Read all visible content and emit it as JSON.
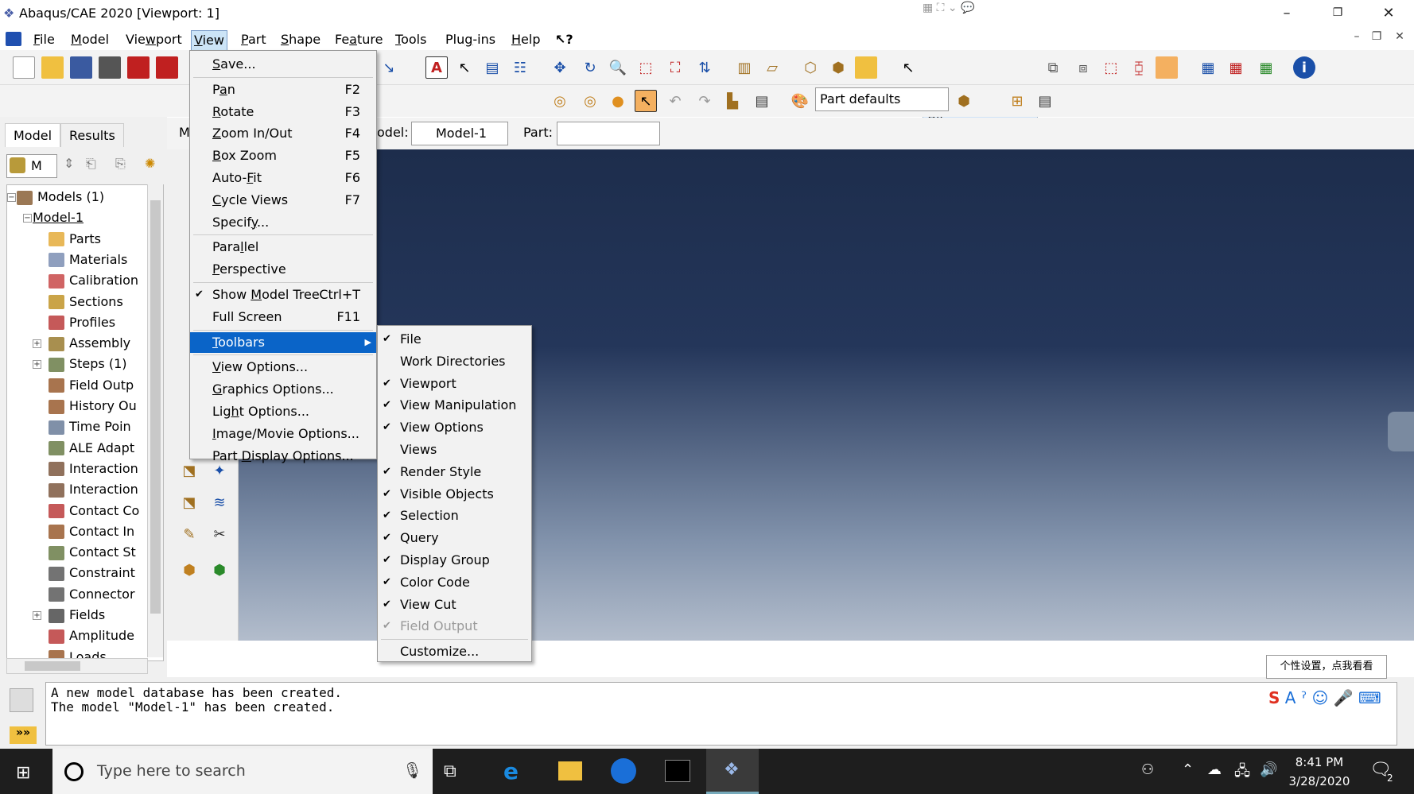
{
  "window": {
    "title": "Abaqus/CAE 2020 [Viewport: 1]",
    "minimize": "–",
    "restore": "❐",
    "close": "✕"
  },
  "menubar": {
    "items": [
      "File",
      "Model",
      "Viewport",
      "View",
      "Part",
      "Shape",
      "Feature",
      "Tools",
      "Plug-ins",
      "Help",
      "⁋?"
    ],
    "help_pointer": "↖?"
  },
  "toolbar": {
    "selection_filter": "All",
    "render_defaults": "Part defaults"
  },
  "context": {
    "module_label": "M",
    "model_label": "odel:",
    "model_value": "Model-1",
    "part_label": "Part:",
    "part_value": ""
  },
  "left_panel": {
    "tabs": [
      "Model",
      "Results"
    ],
    "combo": "M",
    "tree": [
      {
        "label": "Models (1)",
        "level": 0,
        "exp": "−",
        "color": "#7a4b1c"
      },
      {
        "label": "Model-1",
        "level": 1,
        "exp": "−",
        "color": ""
      },
      {
        "label": "Parts",
        "level": 2,
        "exp": "",
        "color": "#e0a020"
      },
      {
        "label": "Materials",
        "level": 2,
        "exp": "",
        "color": "#6a7fa8"
      },
      {
        "label": "Calibration",
        "level": 2,
        "exp": "",
        "color": "#c03030"
      },
      {
        "label": "Sections",
        "level": 2,
        "exp": "",
        "color": "#b8860b"
      },
      {
        "label": "Profiles",
        "level": 2,
        "exp": "",
        "color": "#b22222"
      },
      {
        "label": "Assembly",
        "level": 2,
        "exp": "+",
        "color": "#8b6914"
      },
      {
        "label": "Steps (1)",
        "level": 2,
        "exp": "+",
        "color": "#556b2f"
      },
      {
        "label": "Field Outp",
        "level": 2,
        "exp": "",
        "color": "#8b4513"
      },
      {
        "label": "History Ou",
        "level": 2,
        "exp": "",
        "color": "#8b4513"
      },
      {
        "label": "Time Poin",
        "level": 2,
        "exp": "",
        "color": "#556b8b"
      },
      {
        "label": "ALE Adapt",
        "level": 2,
        "exp": "",
        "color": "#556b2f"
      },
      {
        "label": "Interaction",
        "level": 2,
        "exp": "",
        "color": "#6b4226"
      },
      {
        "label": "Interaction",
        "level": 2,
        "exp": "",
        "color": "#6b4226"
      },
      {
        "label": "Contact Co",
        "level": 2,
        "exp": "",
        "color": "#b22222"
      },
      {
        "label": "Contact In",
        "level": 2,
        "exp": "",
        "color": "#8b4513"
      },
      {
        "label": "Contact St",
        "level": 2,
        "exp": "",
        "color": "#556b2f"
      },
      {
        "label": "Constraint",
        "level": 2,
        "exp": "",
        "color": "#444444"
      },
      {
        "label": "Connector",
        "level": 2,
        "exp": "",
        "color": "#444444"
      },
      {
        "label": "Fields",
        "level": 2,
        "exp": "+",
        "color": "#333333"
      },
      {
        "label": "Amplitude",
        "level": 2,
        "exp": "",
        "color": "#b22222"
      },
      {
        "label": "Loads",
        "level": 2,
        "exp": "",
        "color": "#8b4513"
      }
    ]
  },
  "view_menu": [
    {
      "label": "Save...",
      "u": "S",
      "accel": ""
    },
    {
      "sep": true
    },
    {
      "label": "Pan",
      "u": "a",
      "accel": "F2"
    },
    {
      "label": "Rotate",
      "u": "R",
      "accel": "F3"
    },
    {
      "label": "Zoom In/Out",
      "u": "Z",
      "accel": "F4"
    },
    {
      "label": "Box Zoom",
      "u": "B",
      "accel": "F5"
    },
    {
      "label": "Auto-Fit",
      "u": "F",
      "accel": "F6"
    },
    {
      "label": "Cycle Views",
      "u": "C",
      "accel": "F7"
    },
    {
      "label": "Specify...",
      "u": "y",
      "accel": ""
    },
    {
      "sep": true
    },
    {
      "label": "Parallel",
      "u": "l",
      "accel": ""
    },
    {
      "label": "Perspective",
      "u": "P",
      "accel": ""
    },
    {
      "sep": true
    },
    {
      "label": "Show Model Tree",
      "u": "M",
      "accel": "Ctrl+T",
      "check": true
    },
    {
      "label": "Full Screen",
      "u": "",
      "accel": "F11"
    },
    {
      "sep": true
    },
    {
      "label": "Toolbars",
      "u": "T",
      "accel": "",
      "sub": true,
      "hl": true
    },
    {
      "sep": true
    },
    {
      "label": "View Options...",
      "u": "V",
      "accel": ""
    },
    {
      "label": "Graphics Options...",
      "u": "G",
      "accel": ""
    },
    {
      "label": "Light Options...",
      "u": "h",
      "accel": ""
    },
    {
      "label": "Image/Movie Options...",
      "u": "I",
      "accel": ""
    },
    {
      "label": "Part Display Options...",
      "u": "D",
      "accel": ""
    }
  ],
  "toolbars_menu": [
    {
      "label": "File",
      "check": true
    },
    {
      "label": "Work Directories",
      "check": false
    },
    {
      "label": "Viewport",
      "check": true
    },
    {
      "label": "View Manipulation",
      "check": true
    },
    {
      "label": "View Options",
      "check": true
    },
    {
      "label": "Views",
      "check": false
    },
    {
      "label": "Render Style",
      "check": true
    },
    {
      "label": "Visible Objects",
      "check": true
    },
    {
      "label": "Selection",
      "check": true
    },
    {
      "label": "Query",
      "check": true
    },
    {
      "label": "Display Group",
      "check": true
    },
    {
      "label": "Color Code",
      "check": true
    },
    {
      "label": "View Cut",
      "check": true
    },
    {
      "label": "Field Output",
      "check": true,
      "dis": true
    },
    {
      "sep": true
    },
    {
      "label": "Customize...",
      "check": false
    }
  ],
  "messages": "A new model database has been created.\nThe model \"Model-1\" has been created.",
  "ime_tooltip": "个性设置，点我看看",
  "taskbar": {
    "search_placeholder": "Type here to search",
    "time": "8:41 PM",
    "date": "3/28/2020",
    "notif_count": "2"
  }
}
